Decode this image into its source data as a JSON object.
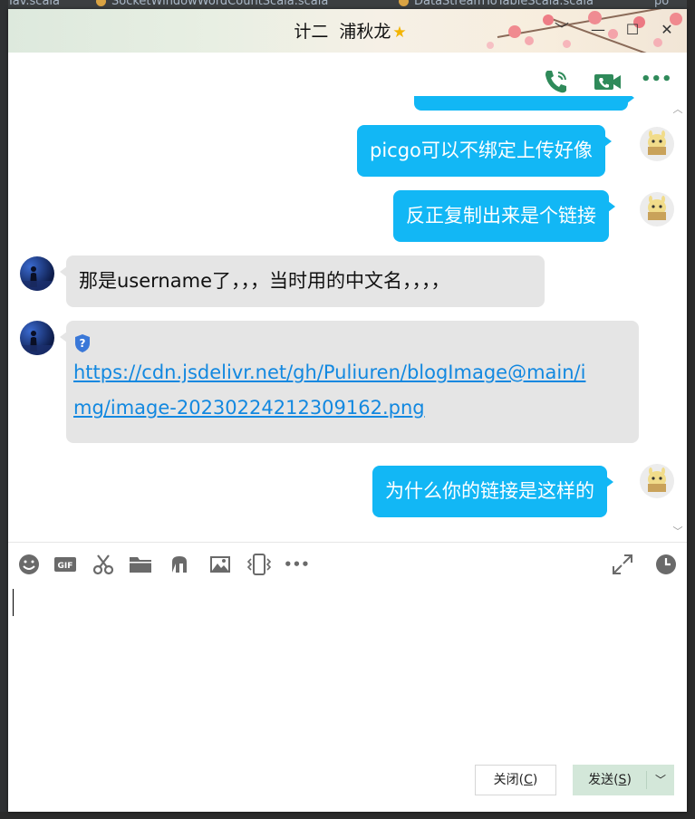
{
  "ide": {
    "tabs": [
      "aTav.scala",
      "SocketWindowWordCountScala.scala",
      "DataStreamToTableScala.scala",
      "po"
    ]
  },
  "window": {
    "title_name1": "计二",
    "title_name2": "浦秋龙",
    "title_star": "★",
    "btn_min": "—",
    "btn_max": "☐",
    "btn_close": "✕",
    "btn_collapse": "﹀"
  },
  "actions": {
    "phone": "phone-call",
    "video": "video-call",
    "more": "•••"
  },
  "messages": [
    {
      "id": "m1",
      "side": "out",
      "text": "picgo可以不绑定上传好像"
    },
    {
      "id": "m2",
      "side": "out",
      "text": "反正复制出来是个链接"
    },
    {
      "id": "m3",
      "side": "in",
      "text": "那是username了，，，当时用的中文名，，，，"
    },
    {
      "id": "m4",
      "side": "in",
      "link_line1": "https://cdn.jsdelivr.net/gh/Puliuren/blogImage@main/i",
      "link_line2": "mg/image-20230224212309162.png"
    },
    {
      "id": "m5",
      "side": "out",
      "text": "为什么你的链接是这样的"
    }
  ],
  "toolbar": {
    "more": "•••"
  },
  "buttons": {
    "close_label": "关闭(",
    "close_key": "C",
    "close_end": ")",
    "send_label": "发送(",
    "send_key": "S",
    "send_end": ")",
    "send_arrow": "﹀"
  },
  "colors": {
    "accent_blue": "#12b7f5",
    "incoming_bubble": "#e5e5e5",
    "icon_green": "#2f8a5a",
    "send_button": "#d3e7d9"
  }
}
